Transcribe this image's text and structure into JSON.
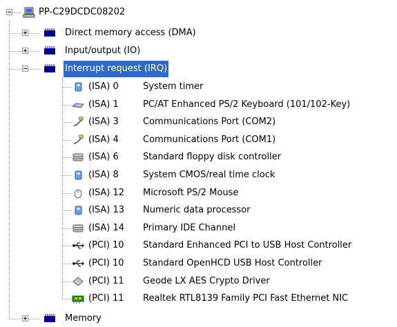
{
  "root": {
    "label": "PP-C29DCDC08202",
    "icon": "computer-icon"
  },
  "categories": {
    "dma": {
      "label": "Direct memory access (DMA)",
      "icon": "hardware-chip-icon"
    },
    "io": {
      "label": "Input/output (IO)",
      "icon": "hardware-chip-icon"
    },
    "irq": {
      "label": "Interrupt request (IRQ)",
      "icon": "hardware-chip-icon",
      "selected": true
    },
    "memory": {
      "label": "Memory",
      "icon": "hardware-chip-icon"
    }
  },
  "irq_items": [
    {
      "bus": "(ISA) 0",
      "device": "System timer",
      "icon": "system-device-icon"
    },
    {
      "bus": "(ISA) 1",
      "device": "PC/AT Enhanced PS/2 Keyboard (101/102-Key)",
      "icon": "keyboard-icon"
    },
    {
      "bus": "(ISA) 3",
      "device": "Communications Port (COM2)",
      "icon": "port-icon"
    },
    {
      "bus": "(ISA) 4",
      "device": "Communications Port (COM1)",
      "icon": "port-icon"
    },
    {
      "bus": "(ISA) 6",
      "device": "Standard floppy disk controller",
      "icon": "disk-controller-icon"
    },
    {
      "bus": "(ISA) 8",
      "device": "System CMOS/real time clock",
      "icon": "system-device-icon"
    },
    {
      "bus": "(ISA) 12",
      "device": "Microsoft PS/2 Mouse",
      "icon": "mouse-icon"
    },
    {
      "bus": "(ISA) 13",
      "device": "Numeric data processor",
      "icon": "system-device-icon"
    },
    {
      "bus": "(ISA) 14",
      "device": "Primary IDE Channel",
      "icon": "disk-controller-icon"
    },
    {
      "bus": "(PCI) 10",
      "device": "Standard Enhanced PCI to USB Host Controller",
      "icon": "usb-icon"
    },
    {
      "bus": "(PCI) 10",
      "device": "Standard OpenHCD USB Host Controller",
      "icon": "usb-icon"
    },
    {
      "bus": "(PCI) 11",
      "device": "Geode LX AES Crypto Driver",
      "icon": "crypto-device-icon"
    },
    {
      "bus": "(PCI) 11",
      "device": "Realtek RTL8139 Family PCI Fast Ethernet NIC",
      "icon": "network-card-icon"
    }
  ],
  "colors": {
    "selection": "#316ac5",
    "chip": "#00008b",
    "tree_line": "#a0a0a0"
  }
}
